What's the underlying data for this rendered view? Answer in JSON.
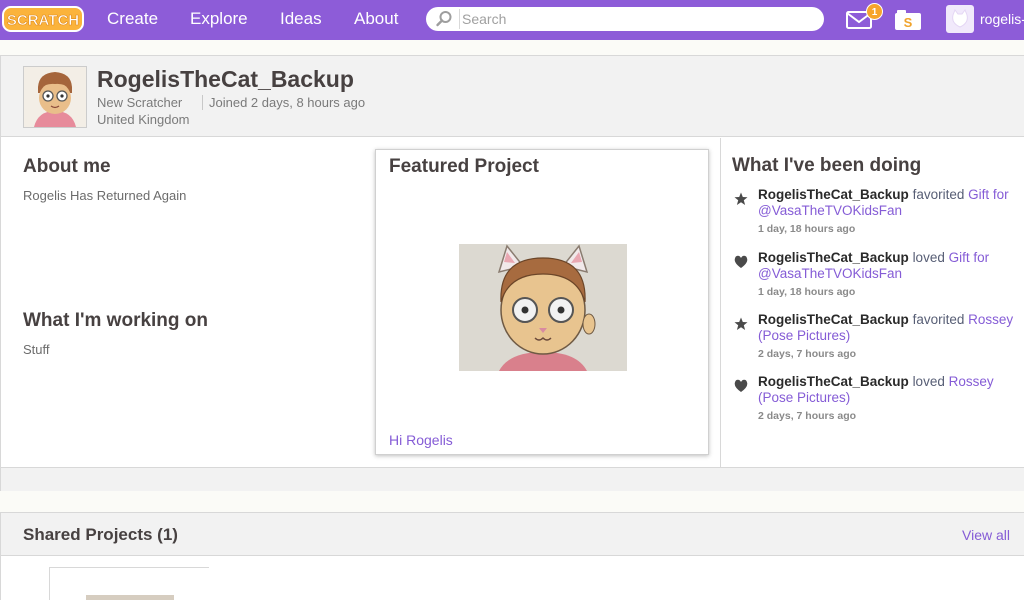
{
  "navbar": {
    "logo_text": "SCRATCH",
    "links": [
      "Create",
      "Explore",
      "Ideas",
      "About"
    ],
    "search_placeholder": "Search",
    "messages_count": "1",
    "username": "rogelis-"
  },
  "profile": {
    "username": "RogelisTheCat_Backup",
    "status": "New Scratcher",
    "joined": "Joined 2 days, 8 hours ago",
    "location": "United Kingdom",
    "about_title": "About me",
    "about_text": "Rogelis Has Returned Again",
    "working_title": "What I'm working on",
    "working_text": "Stuff"
  },
  "featured": {
    "title": "Featured Project",
    "project_name": "Hi Rogelis"
  },
  "activity": {
    "title": "What I've been doing",
    "items": [
      {
        "icon": "star-icon",
        "user": "RogelisTheCat_Backup",
        "action": "favorited",
        "target": "Gift for @VasaTheTVOKidsFan",
        "time": "1 day, 18 hours ago"
      },
      {
        "icon": "heart-icon",
        "user": "RogelisTheCat_Backup",
        "action": "loved",
        "target": "Gift for @VasaTheTVOKidsFan",
        "time": "1 day, 18 hours ago"
      },
      {
        "icon": "star-icon",
        "user": "RogelisTheCat_Backup",
        "action": "favorited",
        "target": "Rossey (Pose Pictures)",
        "time": "2 days, 7 hours ago"
      },
      {
        "icon": "heart-icon",
        "user": "RogelisTheCat_Backup",
        "action": "loved",
        "target": "Rossey (Pose Pictures)",
        "time": "2 days, 7 hours ago"
      }
    ]
  },
  "shared": {
    "title": "Shared Projects (1)",
    "view_all": "View all"
  },
  "colors": {
    "navbar": "#8d5cd8",
    "link": "#855cd6",
    "badge": "#f7a42b"
  }
}
